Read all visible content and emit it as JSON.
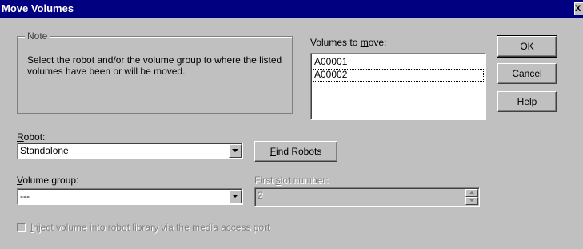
{
  "window": {
    "title": "Move Volumes",
    "close_glyph": "X"
  },
  "note": {
    "legend": "Note",
    "text": "Select the robot and/or the volume group to where the listed volumes have been or will be moved."
  },
  "volumes": {
    "label_pre": "Volumes to ",
    "label_accel": "m",
    "label_post": "ove:",
    "items": [
      "A00001",
      "A00002"
    ]
  },
  "buttons": {
    "ok": "OK",
    "cancel": "Cancel",
    "help": "Help",
    "find_robots_accel": "F",
    "find_robots_rest": "ind Robots"
  },
  "robot": {
    "label_accel": "R",
    "label_rest": "obot:",
    "value": "Standalone"
  },
  "volume_group": {
    "label_accel": "V",
    "label_rest": "olume group:",
    "value": "---"
  },
  "first_slot": {
    "label_pre": "First ",
    "label_accel": "s",
    "label_post": "lot number:",
    "value": "2"
  },
  "inject": {
    "label_accel": "I",
    "label_rest": "nject volume into robot library via the media access port",
    "checked": false
  },
  "icons": {
    "dropdown": "chevron-down-icon",
    "spin_up": "spin-up-icon",
    "spin_down": "spin-down-icon"
  },
  "colors": {
    "titlebar": "#000080",
    "face": "#c0c0c0",
    "disabled_text": "#808080"
  }
}
